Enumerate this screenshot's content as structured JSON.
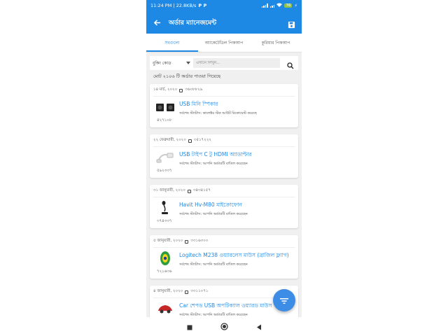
{
  "status_bar": {
    "time_speed": "11:24 PM | 22.8KB/s",
    "battery": "76"
  },
  "app_bar": {
    "title": "অর্ডার ম্যানেজমেন্ট"
  },
  "tabs": [
    {
      "label": "সবগুলো",
      "active": true
    },
    {
      "label": "অ্যাকেটেডিল পিকআপ",
      "active": false
    },
    {
      "label": "কুরিয়ার পিকআপ",
      "active": false
    }
  ],
  "search": {
    "select_label": "বুকিং কোড",
    "placeholder": "এখানে লিখুন..."
  },
  "order_count": "মোট ২১০৬ টি অর্ডার পাওয়া গিয়েছে",
  "orders": [
    {
      "date": "১৪ মার্চ, ২০২০",
      "order_id": "৩৬০৮৮২৯",
      "product": "USB মিনি স্পিকার",
      "status": "সর্বশেষ স্ট্যাটাস: কালেক্টর স্টক আউট রিকোয়েস্ট করেছে",
      "product_id": "৪২৭১০৮",
      "thumb": "speaker-icon"
    },
    {
      "date": "২২ ফেব্রুয়ারী, ২০২০",
      "order_id": "৩৫১৭২২২",
      "product": "USB টাইপ C টু HDMI অ্যাডাপ্টার",
      "status": "সর্বশেষ স্ট্যাটাস: আপনি অর্ডারটি বাতিল করেছেন",
      "product_id": "৫৯২৩৩৭",
      "thumb": "adapter-icon"
    },
    {
      "date": "৩১ জানুয়ারী, ২০২০",
      "order_id": "৩৪৩৪১৫৭",
      "product": "Havit Hv-M80 মাইক্রোফোন",
      "status": "সর্বশেষ স্ট্যাটাস: আপনি অর্ডারটি বাতিল করেছেন",
      "product_id": "৩৭৪৩৩৭",
      "thumb": "microphone-icon"
    },
    {
      "date": "৫ জানুয়ারী, ২০২০",
      "order_id": "৩৩১৬৩০০",
      "product": "Logitech M238 ওয়্যারলেস মাউস (ব্রাজিল ফ্ল্যাগ)",
      "status": "সর্বশেষ স্ট্যাটাস: আপনি অর্ডারটি বাতিল করেছেন",
      "product_id": "৭২১৬৩৬",
      "thumb": "mouse-icon"
    },
    {
      "date": "৪ জানুয়ারী, ২০২০",
      "order_id": "৩৩১১০৭১",
      "product": "Car শেপড USB অপটিক্যাল ওয়্যারড মাউস",
      "status": "সর্বশেষ স্ট্যাটাস: আপনি অর্ডারটি বাতিল করেছেন",
      "product_id": "",
      "thumb": "car-mouse-icon"
    }
  ],
  "colors": {
    "primary": "#1e88e5",
    "fab": "#3d8de6",
    "background": "#f0f0f0"
  }
}
